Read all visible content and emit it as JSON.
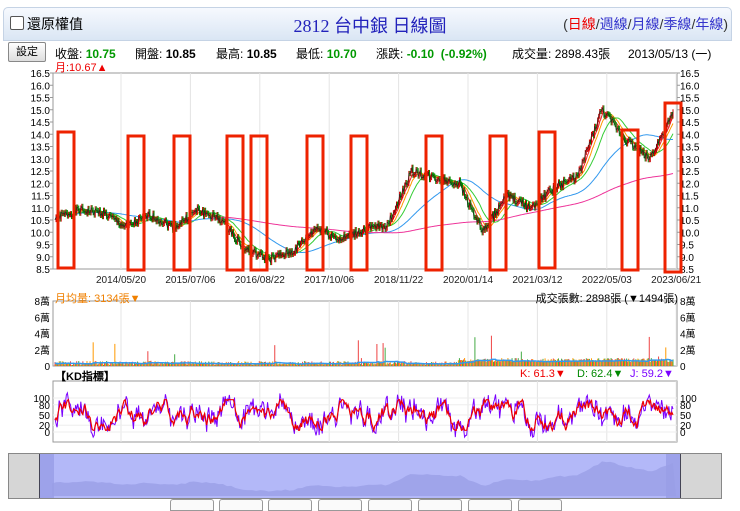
{
  "header": {
    "checkbox_label": "還原權值",
    "title": "2812 台中銀  日線圖",
    "periods": [
      "日線",
      "週線",
      "月線",
      "季線",
      "年線"
    ],
    "active_period": "日線"
  },
  "quote": {
    "settings_label": "設定",
    "close_label": "收盤:",
    "close": "10.75",
    "open_label": "開盤:",
    "open": "10.85",
    "high_label": "最高:",
    "high": "10.85",
    "low_label": "最低:",
    "low": "10.70",
    "change_label": "漲跌:",
    "change": "-0.10",
    "change_pct": "(-0.92%)",
    "volume_label": "成交量:",
    "volume": "2898.43張",
    "date": "2013/05/13 (一)",
    "ma_label": "月:10.67▲"
  },
  "volume_panel": {
    "avg_label": "月均量: 3134張▼",
    "right_label": "成交張數: 2898張 (▼1494張)",
    "y_ticks": [
      "8萬",
      "6萬",
      "4萬",
      "2萬",
      "0"
    ]
  },
  "kd_panel": {
    "title": "【KD指標】",
    "k": "K: 61.3▼",
    "d": "D: 62.4▼",
    "j": "J: 59.2▼",
    "y_ticks": [
      "100",
      "80",
      "50",
      "20",
      "0"
    ]
  },
  "colors": {
    "up": "#e00000",
    "down": "#009900",
    "highlight_box": "#ee2200",
    "k_line": "#ee0000",
    "j_line": "#7a00ff",
    "nav_fill": "#b3b8f8"
  },
  "chart_data": {
    "type": "line",
    "ylim": [
      8.5,
      16.5
    ],
    "y_ticks": [
      "16.5",
      "16.0",
      "15.5",
      "15.0",
      "14.5",
      "14.0",
      "13.5",
      "13.0",
      "12.5",
      "12.0",
      "11.5",
      "11.0",
      "10.5",
      "10.0",
      "9.5",
      "9.0",
      "8.5"
    ],
    "x_ticks": [
      "2014/05/20",
      "2015/07/06",
      "2016/08/22",
      "2017/10/06",
      "2018/11/22",
      "2020/01/14",
      "2021/03/12",
      "2022/05/03",
      "2023/06/21"
    ],
    "close_approx": {
      "dates": [
        "2013/05",
        "2013/09",
        "2014/02",
        "2014/05",
        "2014/08",
        "2015/02",
        "2015/07",
        "2015/10",
        "2016/03",
        "2016/08",
        "2017/01",
        "2017/06",
        "2017/10",
        "2018/05",
        "2018/11",
        "2019/05",
        "2019/10",
        "2020/01",
        "2020/03",
        "2020/07",
        "2021/03",
        "2021/09",
        "2022/01",
        "2022/03",
        "2022/05",
        "2022/10",
        "2023/06"
      ],
      "values": [
        10.6,
        10.9,
        10.8,
        10.2,
        10.7,
        10.2,
        10.9,
        10.5,
        9.3,
        8.9,
        9.2,
        10.2,
        9.7,
        10.1,
        10.3,
        12.5,
        12.2,
        12.0,
        10.0,
        11.5,
        11.0,
        11.8,
        12.3,
        15.0,
        13.8,
        13.0,
        14.8
      ]
    }
  }
}
